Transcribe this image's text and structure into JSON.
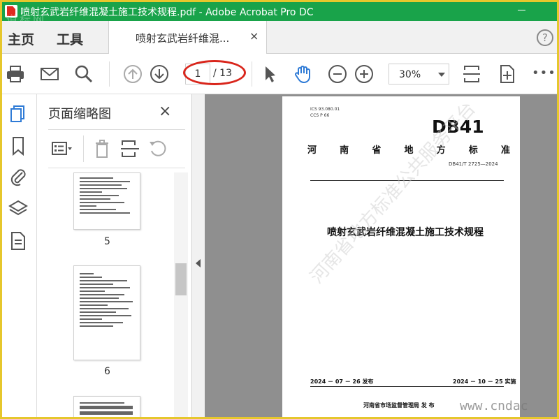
{
  "window": {
    "title": "喷射玄武岩纤维混凝土施工技术规程.pdf - Adobe Acrobat Pro DC",
    "overlay_watermark": "道标网"
  },
  "menu": {
    "home": "主页",
    "tools": "工具"
  },
  "doc_tab": {
    "label": "喷射玄武岩纤维混...",
    "close": "×"
  },
  "toolbar": {
    "page_current": "1",
    "page_total": "/ 13",
    "zoom": "30%",
    "more": "•••",
    "icons": [
      "print-icon",
      "email-icon",
      "search-icon",
      "page-up-icon",
      "page-down-icon",
      "select-arrow-icon",
      "hand-icon",
      "zoom-out-icon",
      "zoom-in-icon",
      "fit-page-icon",
      "full-screen-icon"
    ]
  },
  "rail": {
    "icons": [
      "page-thumbnails-icon",
      "bookmarks-icon",
      "attachments-icon",
      "layers-icon",
      "document-icon"
    ]
  },
  "thumbnail_panel": {
    "title": "页面缩略图",
    "close": "×",
    "pages": [
      {
        "number": "5"
      },
      {
        "number": "6"
      }
    ]
  },
  "document": {
    "ics": "ICS  93.080.01",
    "ccs": "CCS  P 66",
    "badge": "DB41",
    "province_chars": [
      "河",
      "南",
      "省",
      "地",
      "方",
      "标",
      "准"
    ],
    "standard_number": "DB41/T 2725—2024",
    "title": "喷射玄武岩纤维混凝土施工技术规程",
    "publish_date": "2024 － 07 － 26 发布",
    "implement_date": "2024 － 10 － 25 实施",
    "issuer": "河南省市场监督管理局    发  布",
    "watermark": "河南省地方标准公共服务平台"
  },
  "site_watermark": "www.cndac",
  "colors": {
    "titlebar": "#19a34a",
    "frame": "#e6c72c",
    "highlight": "#d9261c"
  }
}
